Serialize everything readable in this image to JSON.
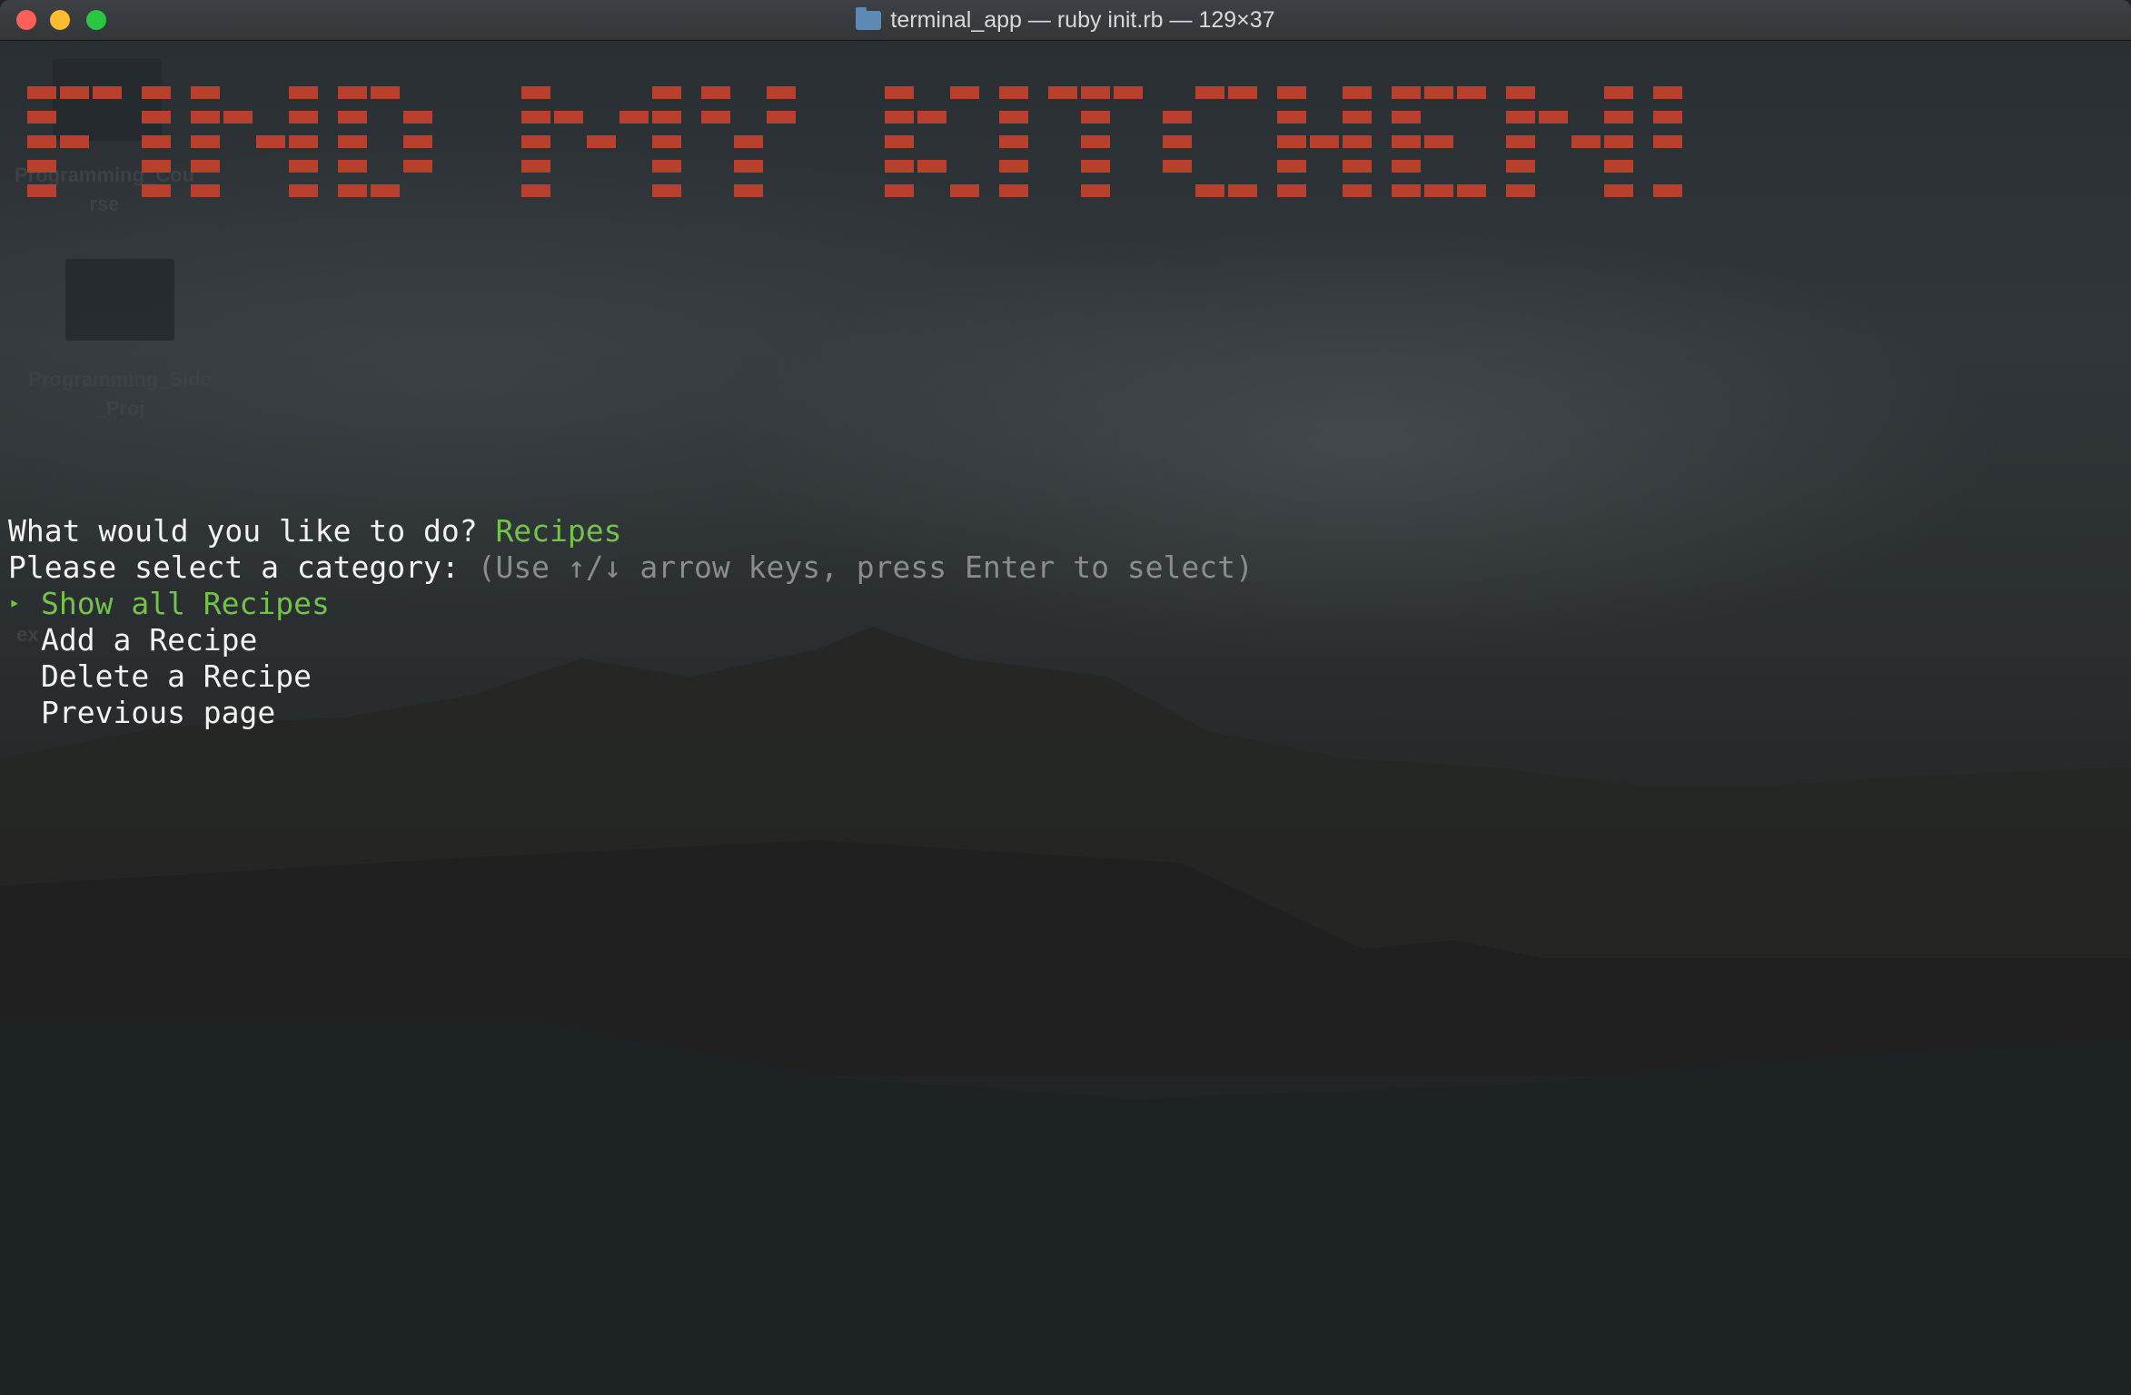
{
  "window": {
    "title": "terminal_app — ruby init.rb — 129×37",
    "title_icon": "folder-icon"
  },
  "banner": {
    "text": "FIND MY KITCHEN!",
    "color": "#b9402d"
  },
  "desktop": {
    "labels": [
      "Programming_Cou",
      "rse",
      "Programming_Side",
      "_Proj",
      "ex"
    ]
  },
  "terminal": {
    "question_prompt": "What would you like to do?",
    "question_answer": "Recipes",
    "select_prompt": "Please select a category:",
    "select_hint": "(Use ↑/↓ arrow keys, press Enter to select)",
    "selected_marker": "‣",
    "options": [
      "Show all Recipes",
      "Add a Recipe",
      "Delete a Recipe",
      "Previous page"
    ],
    "selected_index": 0,
    "colors": {
      "answer": "#73c24a",
      "hint": "#8a8d8f",
      "text": "#f2f2f2"
    }
  }
}
